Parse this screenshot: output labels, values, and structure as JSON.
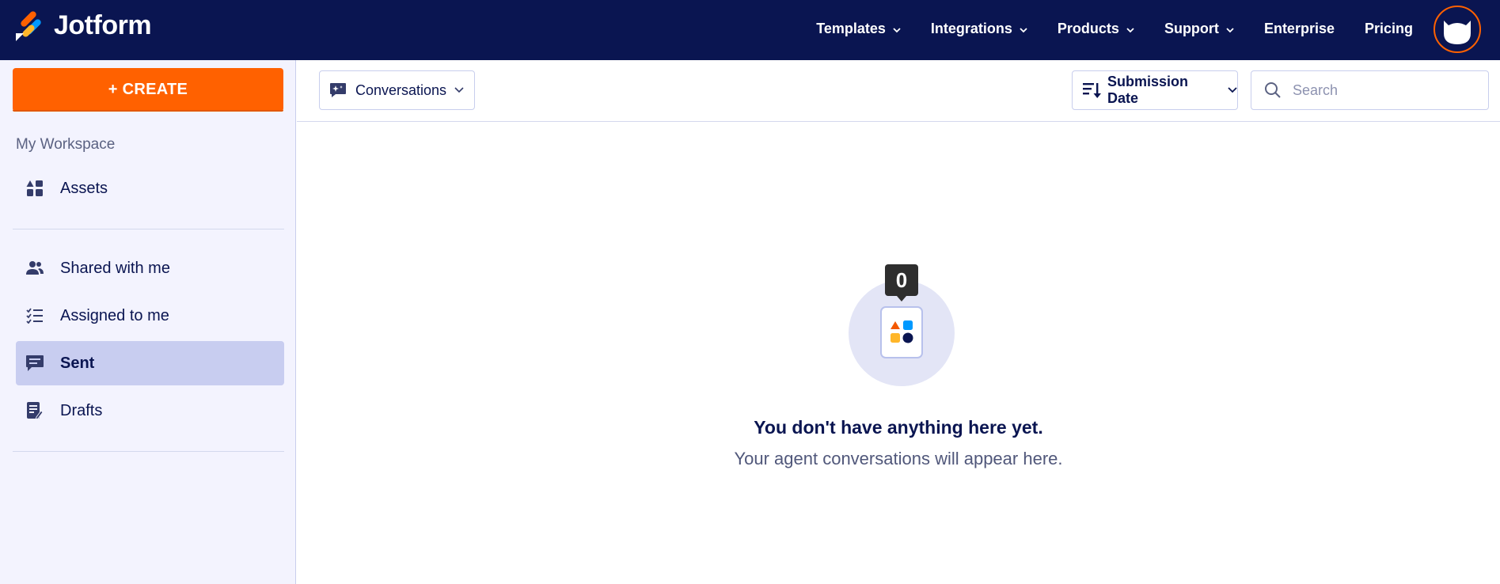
{
  "app": {
    "brand": "Jotform",
    "colors": {
      "navy": "#0a1551",
      "orange": "#ff6100",
      "sidebar_bg": "#f3f3fe",
      "active_bg": "#c8cdf0"
    }
  },
  "nav": {
    "items": [
      {
        "label": "Templates",
        "has_dropdown": true
      },
      {
        "label": "Integrations",
        "has_dropdown": true
      },
      {
        "label": "Products",
        "has_dropdown": true
      },
      {
        "label": "Support",
        "has_dropdown": true
      },
      {
        "label": "Enterprise",
        "has_dropdown": false
      },
      {
        "label": "Pricing",
        "has_dropdown": false
      }
    ],
    "avatar_icon": "user-avatar-icon"
  },
  "sidebar": {
    "create_label": "+ CREATE",
    "workspace_label": "My Workspace",
    "items": [
      {
        "label": "Assets",
        "icon": "assets-icon",
        "active": false
      },
      {
        "label": "Shared with me",
        "icon": "users-icon",
        "active": false
      },
      {
        "label": "Assigned to me",
        "icon": "checklist-icon",
        "active": false
      },
      {
        "label": "Sent",
        "icon": "chat-icon",
        "active": true
      },
      {
        "label": "Drafts",
        "icon": "draft-icon",
        "active": false
      }
    ]
  },
  "toolbar": {
    "filter_label": "Conversations",
    "filter_icon": "ai-chat-icon",
    "sort_label": "Submission Date",
    "sort_icon": "sort-descending-icon",
    "search_placeholder": "Search",
    "search_value": ""
  },
  "empty_state": {
    "count": "0",
    "title": "You don't have anything here yet.",
    "subtitle": "Your agent conversations will appear here."
  }
}
